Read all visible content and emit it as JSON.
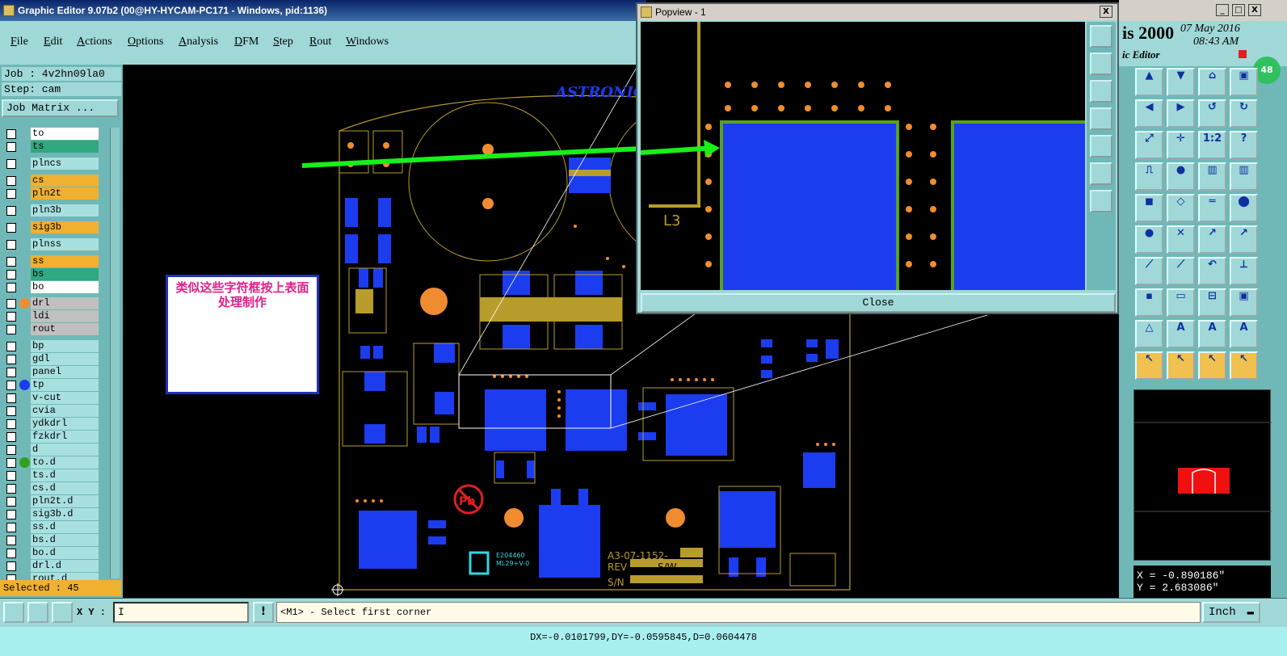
{
  "window": {
    "title": "Graphic Editor 9.07b2 (00@HY-HYCAM-PC171 - Windows, pid:1136)",
    "buttons": [
      "_",
      "□",
      "X"
    ]
  },
  "menu": [
    "File",
    "Edit",
    "Actions",
    "Options",
    "Analysis",
    "DFM",
    "Step",
    "Rout",
    "Windows"
  ],
  "job": {
    "job_label": "Job : 4v2hn09la0",
    "step_label": "Step: cam",
    "matrix_button": "Job Matrix ..."
  },
  "layers": [
    {
      "name": "to",
      "color": "white",
      "marker": "none"
    },
    {
      "name": "ts",
      "color": "green",
      "marker": "none"
    },
    {
      "name": "plncs",
      "color": "cyan",
      "marker": "none"
    },
    {
      "name": "cs",
      "color": "orange",
      "marker": "none"
    },
    {
      "name": "pln2t",
      "color": "orange",
      "marker": "none"
    },
    {
      "name": "pln3b",
      "color": "cyan",
      "marker": "none"
    },
    {
      "name": "sig3b",
      "color": "orange",
      "marker": "none"
    },
    {
      "name": "plnss",
      "color": "cyan",
      "marker": "none"
    },
    {
      "name": "ss",
      "color": "orange",
      "marker": "none"
    },
    {
      "name": "bs",
      "color": "green",
      "marker": "none"
    },
    {
      "name": "bo",
      "color": "white",
      "marker": "none"
    },
    {
      "name": "drl",
      "color": "gray",
      "marker": "orange"
    },
    {
      "name": "ldi",
      "color": "gray",
      "marker": "none"
    },
    {
      "name": "rout",
      "color": "gray",
      "marker": "none"
    },
    {
      "name": "bp",
      "color": "cyan",
      "marker": "none"
    },
    {
      "name": "gdl",
      "color": "cyan",
      "marker": "none"
    },
    {
      "name": "panel",
      "color": "cyan",
      "marker": "none"
    },
    {
      "name": "tp",
      "color": "cyan",
      "marker": "blue"
    },
    {
      "name": "v-cut",
      "color": "cyan",
      "marker": "none"
    },
    {
      "name": "cvia",
      "color": "cyan",
      "marker": "none"
    },
    {
      "name": "ydkdrl",
      "color": "cyan",
      "marker": "none"
    },
    {
      "name": "fzkdrl",
      "color": "cyan",
      "marker": "none"
    },
    {
      "name": "d",
      "color": "cyan",
      "marker": "none"
    },
    {
      "name": "to.d",
      "color": "cyan",
      "marker": "green"
    },
    {
      "name": "ts.d",
      "color": "cyan",
      "marker": "none"
    },
    {
      "name": "cs.d",
      "color": "cyan",
      "marker": "none"
    },
    {
      "name": "pln2t.d",
      "color": "cyan",
      "marker": "none"
    },
    {
      "name": "sig3b.d",
      "color": "cyan",
      "marker": "none"
    },
    {
      "name": "ss.d",
      "color": "cyan",
      "marker": "none"
    },
    {
      "name": "bs.d",
      "color": "cyan",
      "marker": "none"
    },
    {
      "name": "bo.d",
      "color": "cyan",
      "marker": "none"
    },
    {
      "name": "drl.d",
      "color": "cyan",
      "marker": "none"
    },
    {
      "name": "rout.d",
      "color": "cyan",
      "marker": "none"
    }
  ],
  "selected": "Selected : 45",
  "note": "类似这些字符框按上表面处理制作",
  "popview": {
    "title": "Popview - 1",
    "close_label": "Close",
    "label": "L3"
  },
  "board_texts": {
    "brand": "ASTRONICS",
    "ref_2": "2",
    "part": "A3-07-1152-",
    "rev": "REV",
    "sw": "S/W",
    "sn": "S/N",
    "cert1": "E204460",
    "cert2": "ML29+V-0"
  },
  "right": {
    "title_fragment": "is 2000",
    "subtitle_fragment": "ic Editor",
    "date": "07 May 2016",
    "time": "08:43 AM",
    "badge": "48"
  },
  "coords": {
    "x": "X = -0.890186\"",
    "y": "Y = 2.683086\""
  },
  "bottom": {
    "xy_label": "X Y :",
    "xy_value": "I",
    "prompt": "<M1> - Select first corner",
    "units": "Inch"
  },
  "status": "DX=-0.0101799,DY=-0.0595845,D=0.0604478",
  "colors": {
    "teal_bg": "#a0d8d8",
    "pad_blue": "#1c3cf0",
    "trace_gold": "#b89c2c",
    "drill_orange": "#f08c30"
  }
}
